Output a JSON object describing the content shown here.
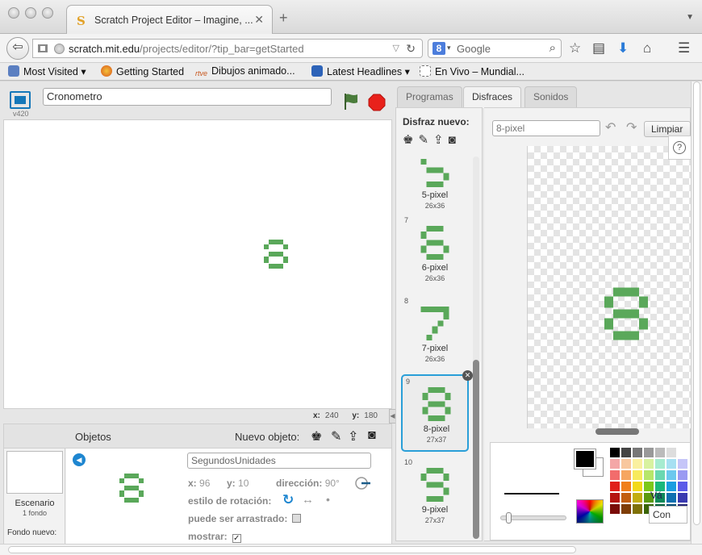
{
  "browser": {
    "tab_title": "Scratch Project Editor – Imagine, ...",
    "tab_favicon": "S",
    "new_tab": "+",
    "url_host": "scratch.mit.edu",
    "url_path": "/projects/editor/?tip_bar=getStarted",
    "search_placeholder": "Google",
    "search_engine_letter": "8"
  },
  "bookmarks": [
    {
      "label": "Most Visited ▾",
      "icon_color": "#5b7fc1"
    },
    {
      "label": "Getting Started",
      "icon_color": "#e07a1f"
    },
    {
      "label": "Dibujos animado...",
      "icon_color": "#f0f0f0"
    },
    {
      "label": "Latest Headlines ▾",
      "icon_color": "#2d63b8"
    },
    {
      "label": "En Vivo – Mundial...",
      "icon_color": "#ffffff"
    }
  ],
  "bookmark_icon_text": {
    "rtve": "rtve"
  },
  "editor": {
    "version": "v420",
    "project_name": "Cronometro",
    "stage_coords": {
      "x_label": "x:",
      "x_value": "240",
      "y_label": "y:",
      "y_value": "180"
    }
  },
  "sprites": {
    "title": "Objetos",
    "new_sprite": "Nuevo objeto:",
    "stage_label": "Escenario",
    "stage_sub": "1 fondo",
    "new_backdrop": "Fondo nuevo:",
    "sprite_name": "SegundosUnidades",
    "x_label": "x:",
    "x_value": "96",
    "y_label": "y:",
    "y_value": "10",
    "direction_label": "dirección:",
    "direction_value": "90°",
    "rotation_label": "estilo de rotación:",
    "draggable_label": "puede ser arrastrado:",
    "show_label": "mostrar:",
    "show_checked": "✓"
  },
  "tabs": [
    {
      "label": "Programas",
      "active": false
    },
    {
      "label": "Disfraces",
      "active": true
    },
    {
      "label": "Sonidos",
      "active": false
    }
  ],
  "costumes_panel": {
    "title": "Disfraz nuevo:",
    "costumes": [
      {
        "num": "",
        "digit": "5",
        "name": "5-pixel",
        "size": "26x36"
      },
      {
        "num": "7",
        "digit": "6",
        "name": "6-pixel",
        "size": "26x36"
      },
      {
        "num": "8",
        "digit": "7",
        "name": "7-pixel",
        "size": "26x36"
      },
      {
        "num": "9",
        "digit": "8",
        "name": "8-pixel",
        "size": "27x37",
        "selected": true
      },
      {
        "num": "10",
        "digit": "9",
        "name": "9-pixel",
        "size": "27x37"
      }
    ]
  },
  "paint_editor": {
    "costume_name": "8-pixel",
    "clear_label": "Limpiar",
    "help": "?",
    "tip_fragment_1": "Vá",
    "tip_fragment_2": "Con"
  },
  "colors": {
    "sprite_green": "#5aa85a",
    "accent_blue": "#2a9fd8",
    "stop_red": "#e8211b",
    "flag_green": "#4a7c3b"
  }
}
